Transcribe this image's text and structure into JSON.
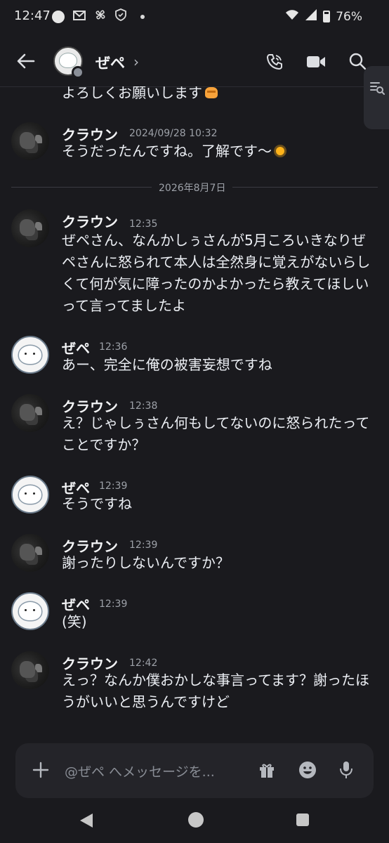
{
  "status_bar": {
    "time": "12:47",
    "battery": "76%",
    "icons": [
      "circle-dot-icon",
      "mail-icon",
      "pinwheel-icon",
      "shield-icon",
      "dot-icon",
      "wifi-icon",
      "signal-icon",
      "battery-icon"
    ]
  },
  "header": {
    "channel_name": "ぜペ",
    "chevron": "›"
  },
  "continued_message": {
    "text": "よろしくお願いします"
  },
  "date_separator": "2026年8月7日",
  "messages": [
    {
      "author": "クラウン",
      "timestamp": "2024/09/28 10:32",
      "text": "そうだったんですね。了解です〜",
      "avatar": "crown"
    },
    {
      "author": "クラウン",
      "timestamp": "12:35",
      "text": "ぜペさん、なんかしぅさんが5月ころいきなりぜペさんに怒られて本人は全然身に覚えがないらしくて何が気に障ったのかよかったら教えてほしいって言ってましたよ",
      "avatar": "crown"
    },
    {
      "author": "ぜペ",
      "timestamp": "12:36",
      "text": "あー、完全に俺の被害妄想ですね",
      "avatar": "zepe"
    },
    {
      "author": "クラウン",
      "timestamp": "12:38",
      "text": "え？じゃしぅさん何もしてないのに怒られたってことですか？",
      "avatar": "crown"
    },
    {
      "author": "ぜペ",
      "timestamp": "12:39",
      "text": "そうですね",
      "avatar": "zepe"
    },
    {
      "author": "クラウン",
      "timestamp": "12:39",
      "text": "謝ったりしないんですか？",
      "avatar": "crown"
    },
    {
      "author": "ぜペ",
      "timestamp": "12:39",
      "text": "(笑)",
      "avatar": "zepe"
    },
    {
      "author": "クラウン",
      "timestamp": "12:42",
      "text": "えっ？なんか僕おかしな事言ってます？謝ったほうがいいと思うんですけど",
      "avatar": "crown"
    }
  ],
  "composer": {
    "placeholder": "@ぜペ へメッセージを..."
  },
  "colors": {
    "background": "#1a1a1e",
    "input_bg": "#242429",
    "muted_text": "#9da1a8"
  }
}
